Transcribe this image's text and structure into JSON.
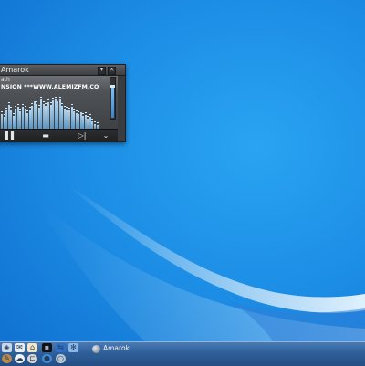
{
  "amarok": {
    "title": "Amarok",
    "line1": "ath",
    "line2": "NSION ***WWW.ALEMIZFM.CO",
    "volume_level": 0.78,
    "analyzer_levels": [
      0.45,
      0.35,
      0.55,
      0.72,
      0.58,
      0.4,
      0.62,
      0.68,
      0.52,
      0.66,
      0.6,
      0.48,
      0.57,
      0.7,
      0.82,
      0.74,
      0.64,
      0.88,
      0.76,
      0.69,
      0.8,
      0.73,
      0.85,
      0.9,
      0.84,
      0.88,
      0.7,
      0.62,
      0.58,
      0.55,
      0.66,
      0.52,
      0.48,
      0.44,
      0.5,
      0.4,
      0.42,
      0.3,
      0.36,
      0.22,
      0.15,
      0.1
    ],
    "controls": {
      "prev": "▌▌",
      "stop": "▬",
      "next": "▷|",
      "more": "⌄"
    },
    "titlebar": {
      "minimize": "▾",
      "close": "×"
    }
  },
  "taskbar": {
    "tasks": [
      {
        "label": "Amarok",
        "icon": "amarok-icon"
      }
    ],
    "launchers": [
      {
        "icon": "kde-menu-icon",
        "color": "#c8d9ee",
        "glyph": "◈"
      },
      {
        "icon": "mail-icon",
        "color": "#e8eef6",
        "glyph": "✉"
      },
      {
        "icon": "home-icon",
        "color": "#f0e6c8",
        "glyph": "⌂"
      },
      {
        "icon": "terminal-icon",
        "color": "#101214",
        "glyph": "▪"
      },
      {
        "icon": "network-icon",
        "color": "#2b6fc6",
        "glyph": "⇆"
      },
      {
        "icon": "settings-icon",
        "color": "#88b7ea",
        "glyph": "✻"
      }
    ],
    "tray": [
      {
        "icon": "pen-icon",
        "color": "#b98b4a",
        "glyph": "✎"
      },
      {
        "icon": "cloud-icon",
        "color": "#eef3fb",
        "glyph": "☁"
      },
      {
        "icon": "drive-icon",
        "color": "#d9d9d9",
        "glyph": "⊏"
      },
      {
        "icon": "chat-icon",
        "color": "#3c8dde",
        "glyph": "●"
      },
      {
        "icon": "power-icon",
        "color": "#b8c7d8",
        "glyph": "○"
      }
    ]
  },
  "colors": {
    "desktop": "#1d8fe6",
    "taskbar": "#2f5f99",
    "widget": "#3a3c3f"
  }
}
